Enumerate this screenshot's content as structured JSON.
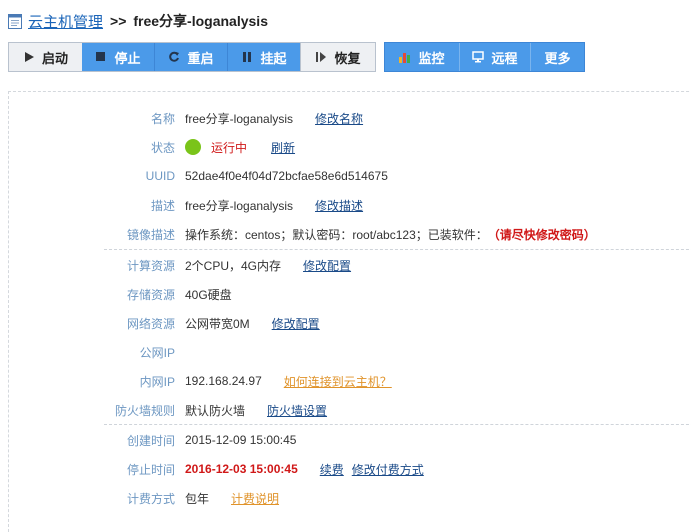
{
  "breadcrumb": {
    "parent": "云主机管理",
    "separator": ">>",
    "current": "free分享-loganalysis"
  },
  "toolbar": {
    "group1": [
      {
        "label": "启动",
        "icon": "play-icon"
      },
      {
        "label": "停止",
        "icon": "stop-icon"
      },
      {
        "label": "重启",
        "icon": "restart-icon"
      },
      {
        "label": "挂起",
        "icon": "pause-icon"
      },
      {
        "label": "恢复",
        "icon": "resume-icon"
      }
    ],
    "group2": [
      {
        "label": "监控",
        "icon": "chart-icon"
      },
      {
        "label": "远程",
        "icon": "monitor-icon"
      },
      {
        "label": "更多"
      }
    ]
  },
  "details": {
    "name": {
      "label": "名称",
      "value": "free分享-loganalysis",
      "link": "修改名称"
    },
    "status": {
      "label": "状态",
      "value": "运行中",
      "link": "刷新",
      "color": "#7ac41a"
    },
    "uuid": {
      "label": "UUID",
      "value": "52dae4f0e4f04d72bcfae58e6d514675"
    },
    "description": {
      "label": "描述",
      "value": "free分享-loganalysis",
      "link": "修改描述"
    },
    "image": {
      "label": "镜像描述",
      "value": "操作系统：centos；默认密码：root/abc123；已装软件：",
      "warning": "（请尽快修改密码）"
    },
    "compute": {
      "label": "计算资源",
      "value": "2个CPU，4G内存",
      "link": "修改配置"
    },
    "storage": {
      "label": "存储资源",
      "value": "40G硬盘"
    },
    "network": {
      "label": "网络资源",
      "value": "公网带宽0M",
      "link": "修改配置"
    },
    "public_ip": {
      "label": "公网IP",
      "value": ""
    },
    "private_ip": {
      "label": "内网IP",
      "value": "192.168.24.97",
      "link": "如何连接到云主机？"
    },
    "firewall": {
      "label": "防火墙规则",
      "value": "默认防火墙",
      "link": "防火墙设置"
    },
    "created": {
      "label": "创建时间",
      "value": "2015-12-09 15:00:45"
    },
    "stop_time": {
      "label": "停止时间",
      "value": "2016-12-03 15:00:45",
      "link1": "续费",
      "link2": "修改付费方式"
    },
    "billing": {
      "label": "计费方式",
      "value": "包年",
      "link": "计费说明"
    }
  }
}
